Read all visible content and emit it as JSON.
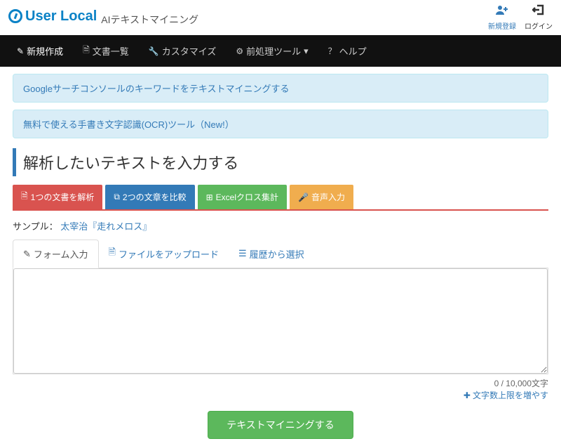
{
  "header": {
    "logo_text": "User Local",
    "logo_sub": "AIテキストマイニング",
    "signup": "新規登録",
    "login": "ログイン"
  },
  "nav": {
    "new": "新規作成",
    "list": "文書一覧",
    "customize": "カスタマイズ",
    "preprocess": "前処理ツール",
    "help": "ヘルプ"
  },
  "alerts": {
    "a1": "Googleサーチコンソールのキーワードをテキストマイニングする",
    "a2": "無料で使える手書き文字認識(OCR)ツール（New!）"
  },
  "page_title": "解析したいテキストを入力する",
  "action_tabs": {
    "one_doc": "1つの文書を解析",
    "compare": "2つの文章を比較",
    "excel": "Excelクロス集計",
    "voice": "音声入力"
  },
  "sample": {
    "label": "サンプル： ",
    "link": "太宰治『走れメロス』"
  },
  "input_tabs": {
    "form": "フォーム入力",
    "upload": "ファイルをアップロード",
    "history": "履歴から選択"
  },
  "textarea_value": "",
  "counter": "0 / 10,000文字",
  "limit_link": "文字数上限を増やす",
  "submit": "テキストマイニングする"
}
